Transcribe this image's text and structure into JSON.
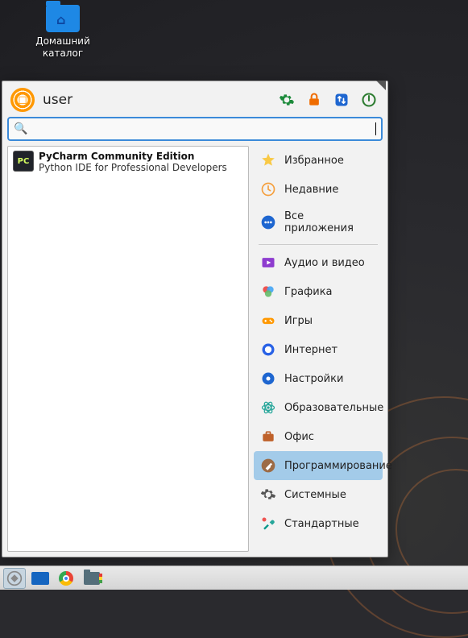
{
  "desktop": {
    "home_label": "Домашний\nкаталог"
  },
  "menu": {
    "user": "user",
    "header_icons": {
      "settings": "settings-icon",
      "lock": "lock-icon",
      "updown": "swap-icon",
      "logout": "logout-icon"
    },
    "search": {
      "value": ""
    }
  },
  "apps": [
    {
      "id": "pycharm",
      "name": "PyCharm Community Edition",
      "desc": "Python IDE for Professional Developers",
      "badge": "PC"
    }
  ],
  "categories": {
    "top": [
      {
        "id": "fav",
        "label": "Избранное",
        "icon": "star",
        "color": "#f9c946"
      },
      {
        "id": "recent",
        "label": "Недавние",
        "icon": "clock",
        "color": "#f59f3d"
      },
      {
        "id": "all",
        "label": "Все приложения",
        "icon": "dots",
        "color": "#1e66d0"
      }
    ],
    "main": [
      {
        "id": "av",
        "label": "Аудио и видео",
        "icon": "play",
        "color": "#8e3ccf"
      },
      {
        "id": "gfx",
        "label": "Графика",
        "icon": "palette",
        "color": "#ff5252"
      },
      {
        "id": "games",
        "label": "Игры",
        "icon": "gamepad",
        "color": "#ff9800"
      },
      {
        "id": "net",
        "label": "Интернет",
        "icon": "globe",
        "color": "#2962e6"
      },
      {
        "id": "pref",
        "label": "Настройки",
        "icon": "cog",
        "color": "#1e66d0"
      },
      {
        "id": "edu",
        "label": "Образовательные",
        "icon": "atom",
        "color": "#26a69a"
      },
      {
        "id": "office",
        "label": "Офис",
        "icon": "briefcase",
        "color": "#bf612a"
      },
      {
        "id": "dev",
        "label": "Программирование",
        "icon": "hammer",
        "color": "#9c6b46",
        "active": true
      },
      {
        "id": "sys",
        "label": "Системные",
        "icon": "gear",
        "color": "#555555"
      },
      {
        "id": "std",
        "label": "Стандартные",
        "icon": "tools",
        "color": "#009688"
      }
    ]
  },
  "taskbar": {
    "items": [
      "menu",
      "show-desktop",
      "browser",
      "files"
    ],
    "active": "menu"
  }
}
